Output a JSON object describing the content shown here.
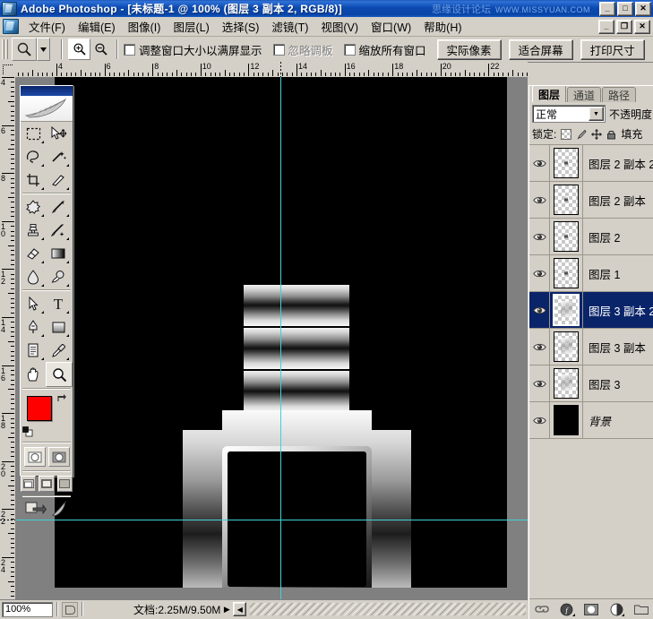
{
  "window": {
    "title": "Adobe Photoshop - [未标题-1 @ 100% (图层 3 副本 2, RGB/8)]",
    "app_icon": "photoshop-icon",
    "watermark": "思缘设计论坛",
    "watermark_url": "WWW.MISSYUAN.COM",
    "minimize": "_",
    "maximize": "□",
    "close": "✕"
  },
  "menubar": {
    "doc_icon": "document-icon",
    "items": [
      {
        "label": "文件(F)"
      },
      {
        "label": "编辑(E)"
      },
      {
        "label": "图像(I)"
      },
      {
        "label": "图层(L)"
      },
      {
        "label": "选择(S)"
      },
      {
        "label": "滤镜(T)"
      },
      {
        "label": "视图(V)"
      },
      {
        "label": "窗口(W)"
      },
      {
        "label": "帮助(H)"
      }
    ],
    "minimize": "_",
    "restore": "❐",
    "close": "✕"
  },
  "options_bar": {
    "current_tool": "zoom-tool",
    "zoom_in_label": "zoom-in-icon",
    "zoom_out_label": "zoom-out-icon",
    "checkbox_resize_window": "调整窗口大小以满屏显示",
    "checkbox_ignore_palettes": "忽略调板",
    "checkbox_zoom_all_windows": "缩放所有窗口",
    "button_actual_pixels": "实际像素",
    "button_fit_screen": "适合屏幕",
    "button_print_size": "打印尺寸"
  },
  "rulers": {
    "unit": "cm",
    "horizontal_labels": [
      "4",
      "6",
      "8",
      "10",
      "12",
      "14",
      "16",
      "18",
      "20",
      "22"
    ],
    "vertical_labels": [
      "4",
      "6",
      "8",
      "10",
      "12",
      "14",
      "16",
      "18",
      "20",
      "22",
      "24"
    ]
  },
  "canvas": {
    "background_color": "#000000",
    "guide_color": "#3fd2d6",
    "guides": [
      "vertical-center-guide",
      "horizontal-guide"
    ],
    "artwork": "metallic-watch-shape"
  },
  "statusbar": {
    "zoom": "100%",
    "preview_icon": "preview-icon",
    "doc_info": "文档:2.25M/9.50M",
    "arrow": "▶",
    "menu_arrow": "◀"
  },
  "toolbox": {
    "logo": "feather-logo",
    "tools": [
      {
        "name": "marquee-tool",
        "glyph": "marquee"
      },
      {
        "name": "move-tool",
        "glyph": "move"
      },
      {
        "name": "lasso-tool",
        "glyph": "lasso"
      },
      {
        "name": "magic-wand-tool",
        "glyph": "wand"
      },
      {
        "name": "crop-tool",
        "glyph": "crop"
      },
      {
        "name": "slice-tool",
        "glyph": "slice"
      },
      {
        "name": "healing-brush-tool",
        "glyph": "heal"
      },
      {
        "name": "brush-tool",
        "glyph": "brush"
      },
      {
        "name": "clone-stamp-tool",
        "glyph": "stamp"
      },
      {
        "name": "history-brush-tool",
        "glyph": "historybrush"
      },
      {
        "name": "eraser-tool",
        "glyph": "eraser"
      },
      {
        "name": "gradient-tool",
        "glyph": "gradient"
      },
      {
        "name": "blur-tool",
        "glyph": "blur"
      },
      {
        "name": "dodge-tool",
        "glyph": "dodge"
      },
      {
        "name": "path-selection-tool",
        "glyph": "pathselect"
      },
      {
        "name": "type-tool",
        "glyph": "T"
      },
      {
        "name": "pen-tool",
        "glyph": "pen"
      },
      {
        "name": "shape-tool",
        "glyph": "shape"
      },
      {
        "name": "notes-tool",
        "glyph": "notes"
      },
      {
        "name": "eyedropper-tool",
        "glyph": "eyedropper"
      },
      {
        "name": "hand-tool",
        "glyph": "hand"
      },
      {
        "name": "zoom-tool",
        "glyph": "zoom"
      }
    ],
    "foreground_color": "#ff0000",
    "background_color": "#ffffff",
    "swap_icon": "swap-colors-icon",
    "default_icon": "default-colors-icon",
    "quickmask": [
      "standard-mode-icon",
      "quickmask-mode-icon"
    ],
    "screenmode": [
      "standard-screen-icon",
      "fullscreen-menubar-icon",
      "fullscreen-icon"
    ],
    "jump_to": [
      "jump-to-imageready-icon",
      "toolbox-extra-icon"
    ]
  },
  "layers_panel": {
    "tabs": [
      {
        "label": "图层",
        "active": true
      },
      {
        "label": "通道",
        "active": false
      },
      {
        "label": "路径",
        "active": false
      }
    ],
    "blend_mode": "正常",
    "blend_arrow": "▼",
    "opacity_label": "不透明度",
    "lock_label": "锁定:",
    "fill_label": "填充",
    "lock_icons": [
      "lock-transparency-icon",
      "lock-image-icon",
      "lock-position-icon",
      "lock-all-icon"
    ],
    "layers": [
      {
        "name": "图层 2 副本 2",
        "visible": true,
        "selected": false,
        "thumb": "transparent"
      },
      {
        "name": "图层 2 副本",
        "visible": true,
        "selected": false,
        "thumb": "transparent"
      },
      {
        "name": "图层 2",
        "visible": true,
        "selected": false,
        "thumb": "transparent"
      },
      {
        "name": "图层 1",
        "visible": true,
        "selected": false,
        "thumb": "transparent"
      },
      {
        "name": "图层 3 副本 2",
        "visible": true,
        "selected": true,
        "thumb": "transparent"
      },
      {
        "name": "图层 3 副本",
        "visible": true,
        "selected": false,
        "thumb": "transparent"
      },
      {
        "name": "图层 3",
        "visible": true,
        "selected": false,
        "thumb": "transparent"
      },
      {
        "name": "背景",
        "visible": true,
        "selected": false,
        "thumb": "black"
      }
    ],
    "bottom_buttons": [
      {
        "name": "link-layers-button",
        "glyph": "link"
      },
      {
        "name": "layer-style-button",
        "glyph": "fx"
      },
      {
        "name": "layer-mask-button",
        "glyph": "mask"
      },
      {
        "name": "adjustment-layer-button",
        "glyph": "halfcircle"
      },
      {
        "name": "new-group-button",
        "glyph": "folder"
      }
    ]
  }
}
